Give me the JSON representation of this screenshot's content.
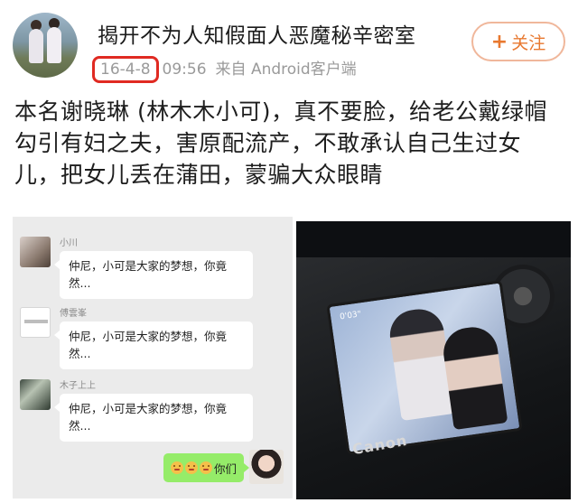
{
  "header": {
    "username": "揭开不为人知假面人恶魔秘辛密室",
    "date": "16-4-8",
    "time": "09:56",
    "source": "来自 Android客户端",
    "follow_plus": "+",
    "follow_label": "关注"
  },
  "post": {
    "text": "本名谢晓琳 (林木木小可)，真不要脸，给老公戴绿帽勾引有妇之夫，害原配流产，不敢承认自己生过女儿，把女儿丢在蒲田，蒙骗大众眼睛"
  },
  "chat": {
    "messages": [
      {
        "name": "小川",
        "text": "仲尼，小可是大家的梦想，你竟然..."
      },
      {
        "name": "傅雲峯",
        "text": "仲尼，小可是大家的梦想，你竟然..."
      },
      {
        "name": "木子上上",
        "text": "仲尼，小可是大家的梦想，你竟然..."
      }
    ],
    "my_message": "你们"
  },
  "photo": {
    "hud_text": "0'03\"",
    "brand": "Canon"
  },
  "colors": {
    "highlight_border": "#e02a22",
    "follow_text": "#e8782f",
    "chat_bg": "#ebebeb",
    "my_bubble": "#95ec69"
  }
}
